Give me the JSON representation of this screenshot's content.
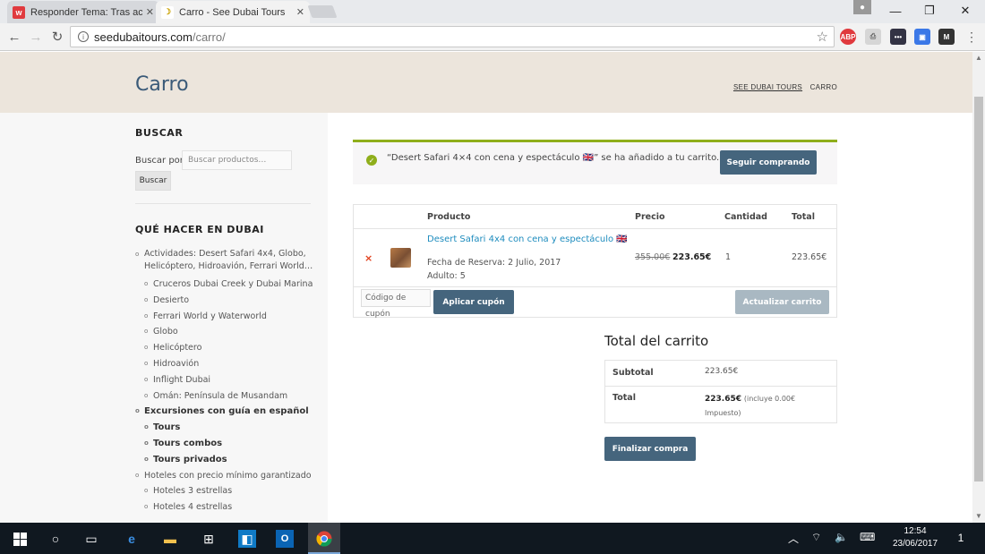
{
  "browser": {
    "tabs": [
      {
        "title": "Responder Tema: Tras aco",
        "favicon": "w",
        "favicon_color": "#e03a3e"
      },
      {
        "title": "Carro - See Dubai Tours",
        "favicon": "dubai-tours-icon",
        "favicon_color": "#ffffff"
      }
    ],
    "url_host": "seedubaitours.com",
    "url_path": "/carro/",
    "extensions": [
      "ABP",
      "pdf-icon",
      "dots-icon",
      "cast-icon",
      "M"
    ]
  },
  "page": {
    "title": "Carro",
    "breadcrumb": {
      "home": "SEE DUBAI TOURS",
      "current": "CARRO"
    }
  },
  "sidebar": {
    "search_heading": "BUSCAR",
    "search_label": "Buscar por:",
    "search_placeholder": "Buscar productos…",
    "search_button": "Buscar",
    "categories_heading": "QUÉ HACER EN DUBAI",
    "categories": [
      {
        "label": "Actividades: Desert Safari 4x4, Globo, Helicóptero, Hidroavión, Ferrari World…",
        "level": 0,
        "bold": false
      },
      {
        "label": "Cruceros Dubai Creek y Dubai Marina",
        "level": 1,
        "bold": false
      },
      {
        "label": "Desierto",
        "level": 1,
        "bold": false
      },
      {
        "label": "Ferrari World y Waterworld",
        "level": 1,
        "bold": false
      },
      {
        "label": "Globo",
        "level": 1,
        "bold": false
      },
      {
        "label": "Helicóptero",
        "level": 1,
        "bold": false
      },
      {
        "label": "Hidroavión",
        "level": 1,
        "bold": false
      },
      {
        "label": "Inflight Dubai",
        "level": 1,
        "bold": false
      },
      {
        "label": "Omán: Península de Musandam",
        "level": 1,
        "bold": false
      },
      {
        "label": "Excursiones con guía en español",
        "level": 0,
        "bold": true
      },
      {
        "label": "Tours",
        "level": 1,
        "bold": true
      },
      {
        "label": "Tours combos",
        "level": 1,
        "bold": true
      },
      {
        "label": "Tours privados",
        "level": 1,
        "bold": true
      },
      {
        "label": "Hoteles con precio mínimo garantizado",
        "level": 0,
        "bold": false
      },
      {
        "label": "Hoteles 3 estrellas",
        "level": 1,
        "bold": false
      },
      {
        "label": "Hoteles 4 estrellas",
        "level": 1,
        "bold": false
      }
    ]
  },
  "notice": {
    "message": "“Desert Safari 4×4 con cena y espectáculo 🇬🇧” se ha añadido a tu carrito.",
    "button": "Seguir comprando",
    "accent_color": "#8fae1b"
  },
  "cart": {
    "headers": {
      "product": "Producto",
      "price": "Precio",
      "quantity": "Cantidad",
      "total": "Total"
    },
    "items": [
      {
        "remove": "×",
        "name": "Desert Safari 4x4 con cena y espectáculo 🇬🇧",
        "meta_date": "Fecha de Reserva: 2 Julio, 2017",
        "meta_adults": "Adulto: 5",
        "price_old": "355.00€",
        "price_new": "223.65€",
        "quantity": "1",
        "total": "223.65€"
      }
    ],
    "coupon_placeholder": "Código de cupón",
    "apply_coupon": "Aplicar cupón",
    "update_cart": "Actualizar carrito"
  },
  "totals": {
    "title": "Total del carrito",
    "subtotal_label": "Subtotal",
    "subtotal_value": "223.65€",
    "total_label": "Total",
    "total_value": "223.65€",
    "tax_note": "(incluye 0.00€",
    "tax_note_2": "Impuesto)",
    "checkout": "Finalizar compra"
  },
  "taskbar": {
    "time": "12:54",
    "date": "23/06/2017",
    "notifications": "1"
  },
  "colors": {
    "brand_button": "#45657d",
    "link": "#1e8cbe",
    "header_bg": "#ece5dc"
  }
}
